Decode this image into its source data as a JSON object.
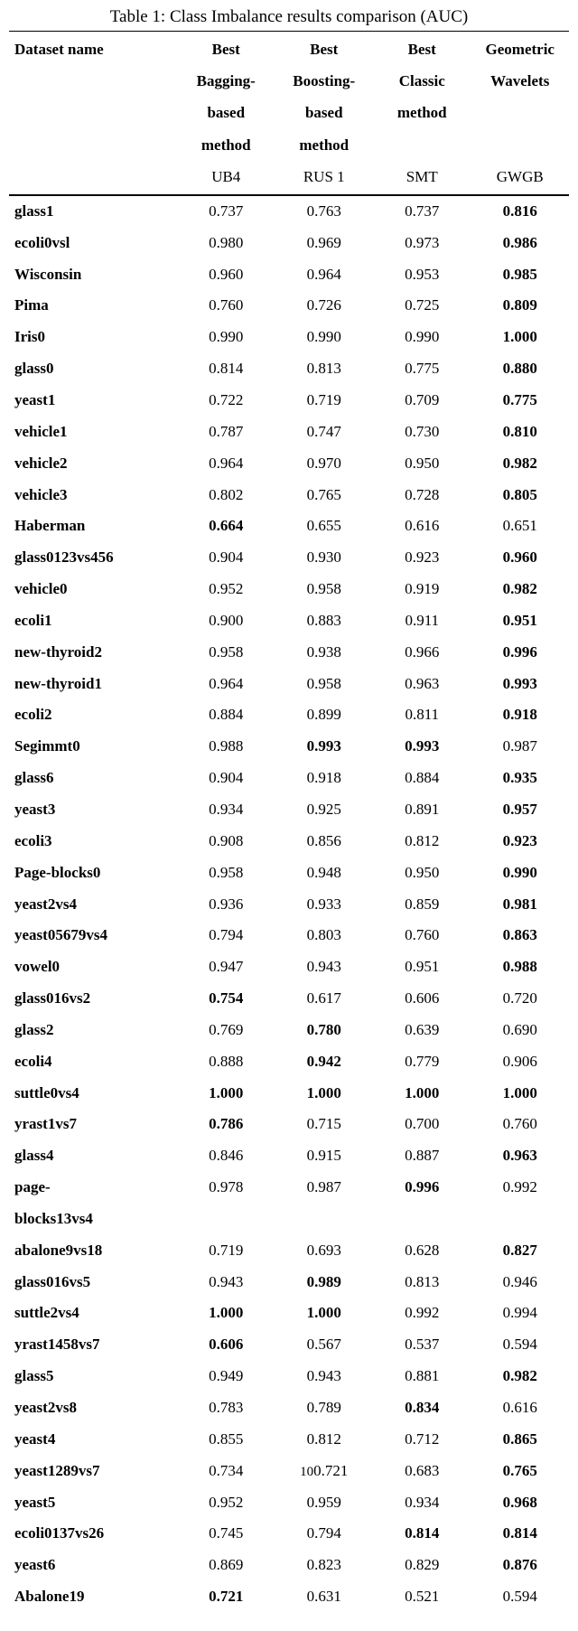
{
  "caption": "Table 1: Class Imbalance results comparison (AUC)",
  "header": {
    "c0": "Dataset name",
    "c1": [
      "Best",
      "Bagging-",
      "based",
      "method"
    ],
    "c2": [
      "Best",
      "Boosting-",
      "based",
      "method"
    ],
    "c3": [
      "Best",
      "Classic",
      "method",
      ""
    ],
    "c4": [
      "Geometric",
      "Wavelets",
      "",
      ""
    ]
  },
  "subheader": {
    "c0": "",
    "c1": "UB4",
    "c2": "RUS 1",
    "c3": "SMT",
    "c4": "GWGB"
  },
  "stray_text": "10",
  "stray_after_row": 39,
  "chart_data": {
    "type": "table",
    "columns": [
      "Dataset name",
      "Best Bagging-based method (UB4)",
      "Best Boosting-based method (RUS 1)",
      "Best Classic method (SMT)",
      "Geometric Wavelets (GWGB)"
    ],
    "rows": [
      {
        "name": "glass1",
        "v": [
          "0.737",
          "0.763",
          "0.737",
          "0.816"
        ],
        "bold": [
          false,
          false,
          false,
          true
        ]
      },
      {
        "name": "ecoli0vsl",
        "v": [
          "0.980",
          "0.969",
          "0.973",
          "0.986"
        ],
        "bold": [
          false,
          false,
          false,
          true
        ]
      },
      {
        "name": "Wisconsin",
        "v": [
          "0.960",
          "0.964",
          "0.953",
          "0.985"
        ],
        "bold": [
          false,
          false,
          false,
          true
        ]
      },
      {
        "name": "Pima",
        "v": [
          "0.760",
          "0.726",
          "0.725",
          "0.809"
        ],
        "bold": [
          false,
          false,
          false,
          true
        ]
      },
      {
        "name": "Iris0",
        "v": [
          "0.990",
          "0.990",
          "0.990",
          "1.000"
        ],
        "bold": [
          false,
          false,
          false,
          true
        ]
      },
      {
        "name": "glass0",
        "v": [
          "0.814",
          "0.813",
          "0.775",
          "0.880"
        ],
        "bold": [
          false,
          false,
          false,
          true
        ]
      },
      {
        "name": "yeast1",
        "v": [
          "0.722",
          "0.719",
          "0.709",
          "0.775"
        ],
        "bold": [
          false,
          false,
          false,
          true
        ]
      },
      {
        "name": "vehicle1",
        "v": [
          "0.787",
          "0.747",
          "0.730",
          "0.810"
        ],
        "bold": [
          false,
          false,
          false,
          true
        ]
      },
      {
        "name": "vehicle2",
        "v": [
          "0.964",
          "0.970",
          "0.950",
          "0.982"
        ],
        "bold": [
          false,
          false,
          false,
          true
        ]
      },
      {
        "name": "vehicle3",
        "v": [
          "0.802",
          "0.765",
          "0.728",
          "0.805"
        ],
        "bold": [
          false,
          false,
          false,
          true
        ]
      },
      {
        "name": "Haberman",
        "v": [
          "0.664",
          "0.655",
          "0.616",
          "0.651"
        ],
        "bold": [
          true,
          false,
          false,
          false
        ]
      },
      {
        "name": "glass0123vs456",
        "v": [
          "0.904",
          "0.930",
          "0.923",
          "0.960"
        ],
        "bold": [
          false,
          false,
          false,
          true
        ]
      },
      {
        "name": "vehicle0",
        "v": [
          "0.952",
          "0.958",
          "0.919",
          "0.982"
        ],
        "bold": [
          false,
          false,
          false,
          true
        ]
      },
      {
        "name": "ecoli1",
        "v": [
          "0.900",
          "0.883",
          "0.911",
          "0.951"
        ],
        "bold": [
          false,
          false,
          false,
          true
        ]
      },
      {
        "name": "new-thyroid2",
        "v": [
          "0.958",
          "0.938",
          "0.966",
          "0.996"
        ],
        "bold": [
          false,
          false,
          false,
          true
        ]
      },
      {
        "name": "new-thyroid1",
        "v": [
          "0.964",
          "0.958",
          "0.963",
          "0.993"
        ],
        "bold": [
          false,
          false,
          false,
          true
        ]
      },
      {
        "name": "ecoli2",
        "v": [
          "0.884",
          "0.899",
          "0.811",
          "0.918"
        ],
        "bold": [
          false,
          false,
          false,
          true
        ]
      },
      {
        "name": "Segimmt0",
        "v": [
          "0.988",
          "0.993",
          "0.993",
          "0.987"
        ],
        "bold": [
          false,
          true,
          true,
          false
        ]
      },
      {
        "name": "glass6",
        "v": [
          "0.904",
          "0.918",
          "0.884",
          "0.935"
        ],
        "bold": [
          false,
          false,
          false,
          true
        ]
      },
      {
        "name": "yeast3",
        "v": [
          "0.934",
          "0.925",
          "0.891",
          "0.957"
        ],
        "bold": [
          false,
          false,
          false,
          true
        ]
      },
      {
        "name": "ecoli3",
        "v": [
          "0.908",
          "0.856",
          "0.812",
          "0.923"
        ],
        "bold": [
          false,
          false,
          false,
          true
        ]
      },
      {
        "name": "Page-blocks0",
        "v": [
          "0.958",
          "0.948",
          "0.950",
          "0.990"
        ],
        "bold": [
          false,
          false,
          false,
          true
        ]
      },
      {
        "name": "yeast2vs4",
        "v": [
          "0.936",
          "0.933",
          "0.859",
          "0.981"
        ],
        "bold": [
          false,
          false,
          false,
          true
        ]
      },
      {
        "name": "yeast05679vs4",
        "v": [
          "0.794",
          "0.803",
          "0.760",
          "0.863"
        ],
        "bold": [
          false,
          false,
          false,
          true
        ]
      },
      {
        "name": "vowel0",
        "v": [
          "0.947",
          "0.943",
          "0.951",
          "0.988"
        ],
        "bold": [
          false,
          false,
          false,
          true
        ]
      },
      {
        "name": "glass016vs2",
        "v": [
          "0.754",
          "0.617",
          "0.606",
          "0.720"
        ],
        "bold": [
          true,
          false,
          false,
          false
        ]
      },
      {
        "name": "glass2",
        "v": [
          "0.769",
          "0.780",
          "0.639",
          "0.690"
        ],
        "bold": [
          false,
          true,
          false,
          false
        ]
      },
      {
        "name": "ecoli4",
        "v": [
          "0.888",
          "0.942",
          "0.779",
          "0.906"
        ],
        "bold": [
          false,
          true,
          false,
          false
        ]
      },
      {
        "name": "suttle0vs4",
        "v": [
          "1.000",
          "1.000",
          "1.000",
          "1.000"
        ],
        "bold": [
          true,
          true,
          true,
          true
        ]
      },
      {
        "name": "yrast1vs7",
        "v": [
          "0.786",
          "0.715",
          "0.700",
          "0.760"
        ],
        "bold": [
          true,
          false,
          false,
          false
        ]
      },
      {
        "name": "glass4",
        "v": [
          "0.846",
          "0.915",
          "0.887",
          "0.963"
        ],
        "bold": [
          false,
          false,
          false,
          true
        ]
      },
      {
        "name": "page-blocks13vs4",
        "v": [
          "0.978",
          "0.987",
          "0.996",
          "0.992"
        ],
        "bold": [
          false,
          false,
          true,
          false
        ],
        "wrap_name": [
          "page-",
          "blocks13vs4"
        ]
      },
      {
        "name": "abalone9vs18",
        "v": [
          "0.719",
          "0.693",
          "0.628",
          "0.827"
        ],
        "bold": [
          false,
          false,
          false,
          true
        ]
      },
      {
        "name": "glass016vs5",
        "v": [
          "0.943",
          "0.989",
          "0.813",
          "0.946"
        ],
        "bold": [
          false,
          true,
          false,
          false
        ]
      },
      {
        "name": "suttle2vs4",
        "v": [
          "1.000",
          "1.000",
          "0.992",
          "0.994"
        ],
        "bold": [
          true,
          true,
          false,
          false
        ]
      },
      {
        "name": "yrast1458vs7",
        "v": [
          "0.606",
          "0.567",
          "0.537",
          "0.594"
        ],
        "bold": [
          true,
          false,
          false,
          false
        ]
      },
      {
        "name": "glass5",
        "v": [
          "0.949",
          "0.943",
          "0.881",
          "0.982"
        ],
        "bold": [
          false,
          false,
          false,
          true
        ]
      },
      {
        "name": "yeast2vs8",
        "v": [
          "0.783",
          "0.789",
          "0.834",
          "0.616"
        ],
        "bold": [
          false,
          false,
          true,
          false
        ]
      },
      {
        "name": "yeast4",
        "v": [
          "0.855",
          "0.812",
          "0.712",
          "0.865"
        ],
        "bold": [
          false,
          false,
          false,
          true
        ]
      },
      {
        "name": "yeast1289vs7",
        "v": [
          "0.734",
          "0.721",
          "0.683",
          "0.765"
        ],
        "bold": [
          false,
          false,
          false,
          true
        ]
      },
      {
        "name": "yeast5",
        "v": [
          "0.952",
          "0.959",
          "0.934",
          "0.968"
        ],
        "bold": [
          false,
          false,
          false,
          true
        ]
      },
      {
        "name": "ecoli0137vs26",
        "v": [
          "0.745",
          "0.794",
          "0.814",
          "0.814"
        ],
        "bold": [
          false,
          false,
          true,
          true
        ]
      },
      {
        "name": "yeast6",
        "v": [
          "0.869",
          "0.823",
          "0.829",
          "0.876"
        ],
        "bold": [
          false,
          false,
          false,
          true
        ]
      },
      {
        "name": "Abalone19",
        "v": [
          "0.721",
          "0.631",
          "0.521",
          "0.594"
        ],
        "bold": [
          true,
          false,
          false,
          false
        ]
      }
    ]
  }
}
